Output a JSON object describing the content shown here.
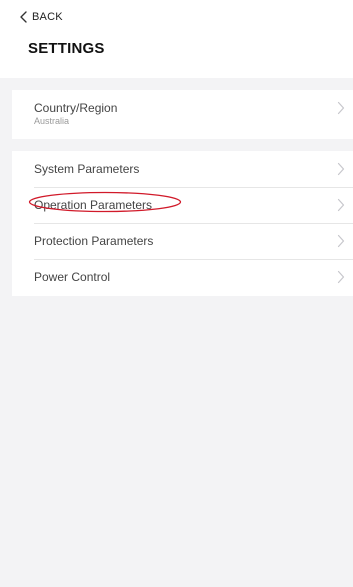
{
  "header": {
    "back_label": "BACK",
    "title": "SETTINGS"
  },
  "groups": [
    {
      "items": [
        {
          "label": "Country/Region",
          "value": "Australia"
        }
      ]
    },
    {
      "items": [
        {
          "label": "System Parameters"
        },
        {
          "label": "Operation Parameters",
          "highlighted": true
        },
        {
          "label": "Protection Parameters"
        },
        {
          "label": "Power Control"
        }
      ]
    }
  ],
  "icons": {
    "back": "chevron-left-icon",
    "row_arrow": "chevron-right-icon"
  },
  "colors": {
    "background": "#f3f3f5",
    "card": "#ffffff",
    "highlight_ring": "#d11a2a"
  }
}
